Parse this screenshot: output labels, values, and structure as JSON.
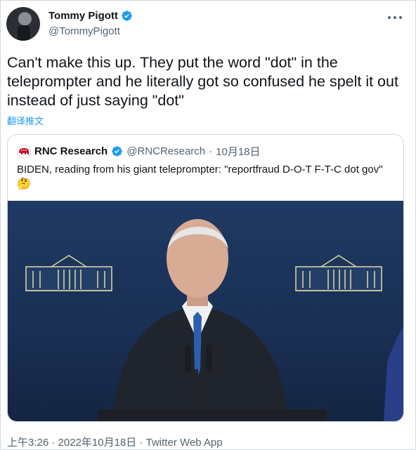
{
  "author": {
    "display_name": "Tommy Pigott",
    "handle": "@TommyPigott"
  },
  "tweet": {
    "text": "Can't make this up. They put the word \"dot\" in the teleprompter and he literally got so confused he spelt it out instead of just saying \"dot\"",
    "translate_label": "翻译推文"
  },
  "quote": {
    "display_name": "RNC Research",
    "handle": "@RNCResearch",
    "separator": "·",
    "date": "10月18日",
    "text": "BIDEN, reading from his giant teleprompter: \"reportfraud D-O-T F-T-C dot gov\"",
    "emoji": "🤔"
  },
  "footer": {
    "time": "上午3:26",
    "separator": "·",
    "date": "2022年10月18日",
    "separator2": "·",
    "source": "Twitter Web App"
  },
  "icons": {
    "verified": "verified-badge-icon",
    "more": "more-options-icon"
  },
  "colors": {
    "accent": "#1d9bf0",
    "muted_text": "#536471",
    "primary_text": "#0f1419",
    "border": "#cfd9de",
    "media_background": "#1f3a63"
  }
}
